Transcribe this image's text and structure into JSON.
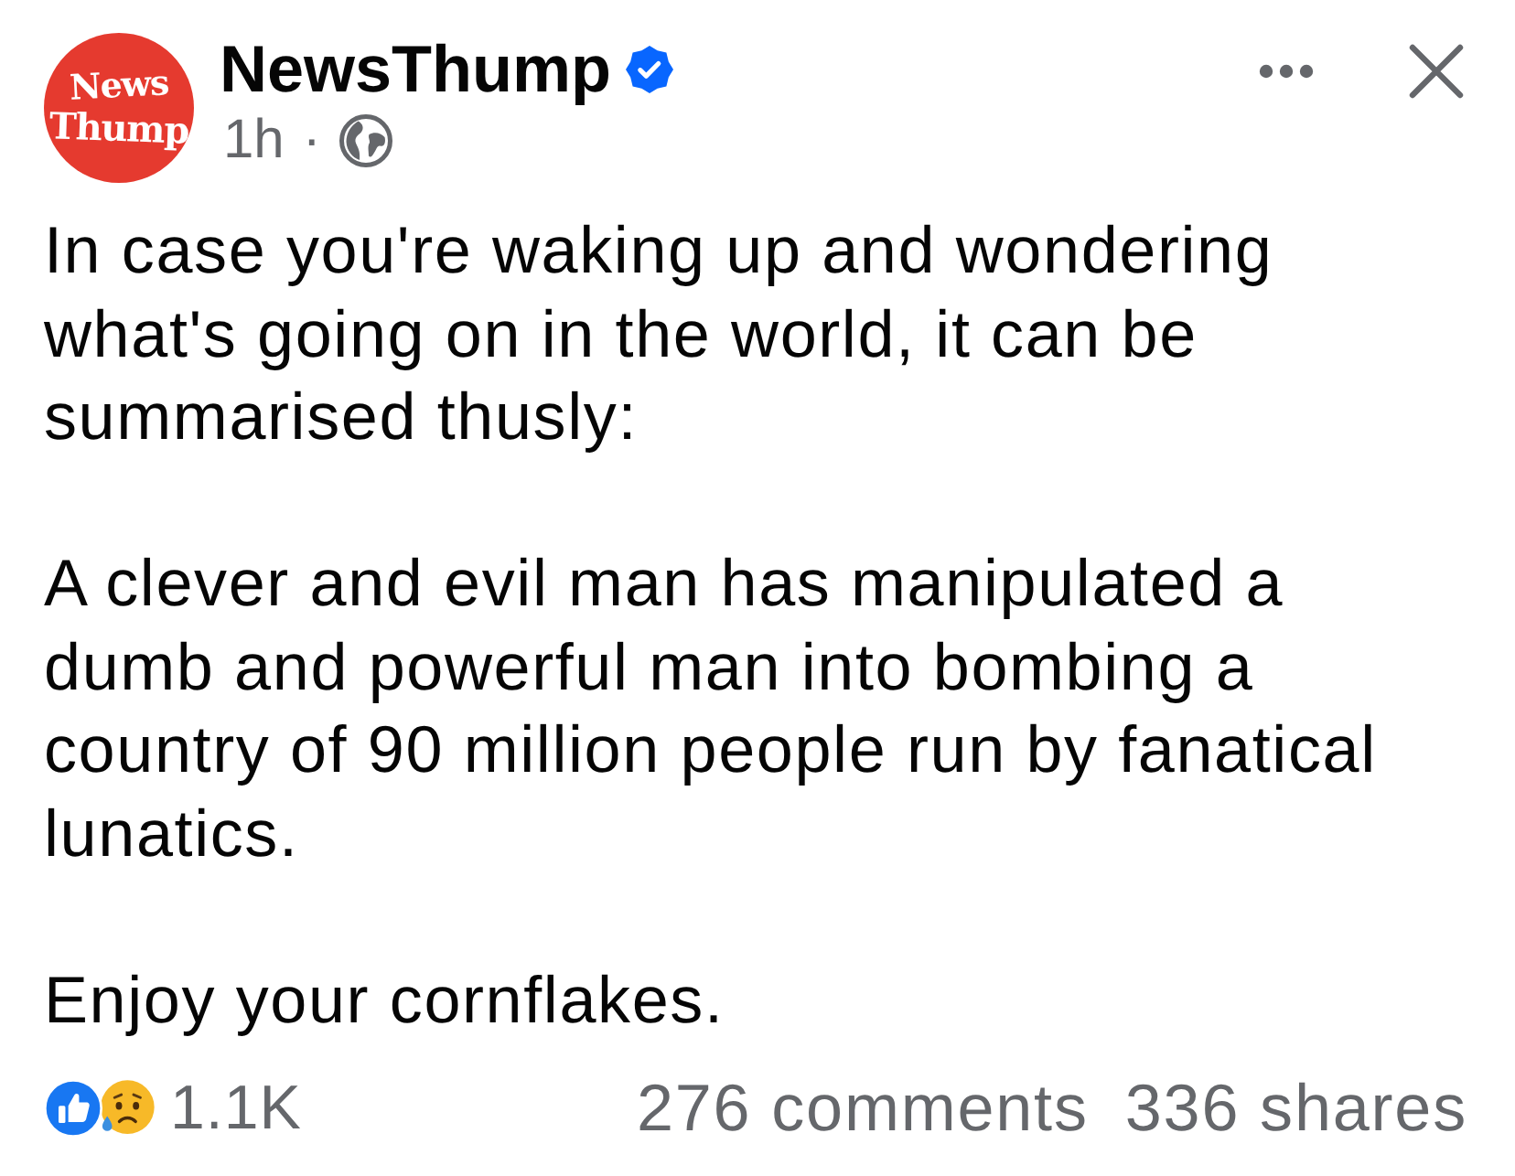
{
  "post": {
    "avatar": {
      "logo_lines": [
        "News",
        "Thump"
      ]
    },
    "author": {
      "name": "NewsThump",
      "verified": true
    },
    "meta": {
      "time": "1h",
      "separator": "·"
    },
    "paragraphs": [
      "In case you're waking up and wondering what's going on in the world, it can be summarised thusly:",
      "A clever and evil man has manipulated a dumb and powerful man into bombing a country of 90 million people run by fanatical lunatics.",
      "Enjoy your cornflakes."
    ]
  },
  "stats": {
    "reactions": [
      {
        "kind": "like"
      },
      {
        "kind": "sad"
      }
    ],
    "reaction_count": "1.1K",
    "comments": "276 comments",
    "shares": "336 shares"
  }
}
